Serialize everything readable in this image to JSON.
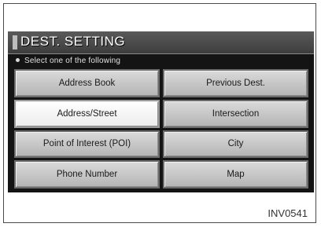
{
  "screen": {
    "title": "DEST. SETTING",
    "prompt": "Select one of the following",
    "buttons": [
      {
        "label": "Address Book",
        "selected": false
      },
      {
        "label": "Previous Dest.",
        "selected": false
      },
      {
        "label": "Address/Street",
        "selected": true
      },
      {
        "label": "Intersection",
        "selected": false
      },
      {
        "label": "Point of Interest (POI)",
        "selected": false
      },
      {
        "label": "City",
        "selected": false
      },
      {
        "label": "Phone Number",
        "selected": false
      },
      {
        "label": "Map",
        "selected": false
      }
    ]
  },
  "figure_code": "INV0541"
}
